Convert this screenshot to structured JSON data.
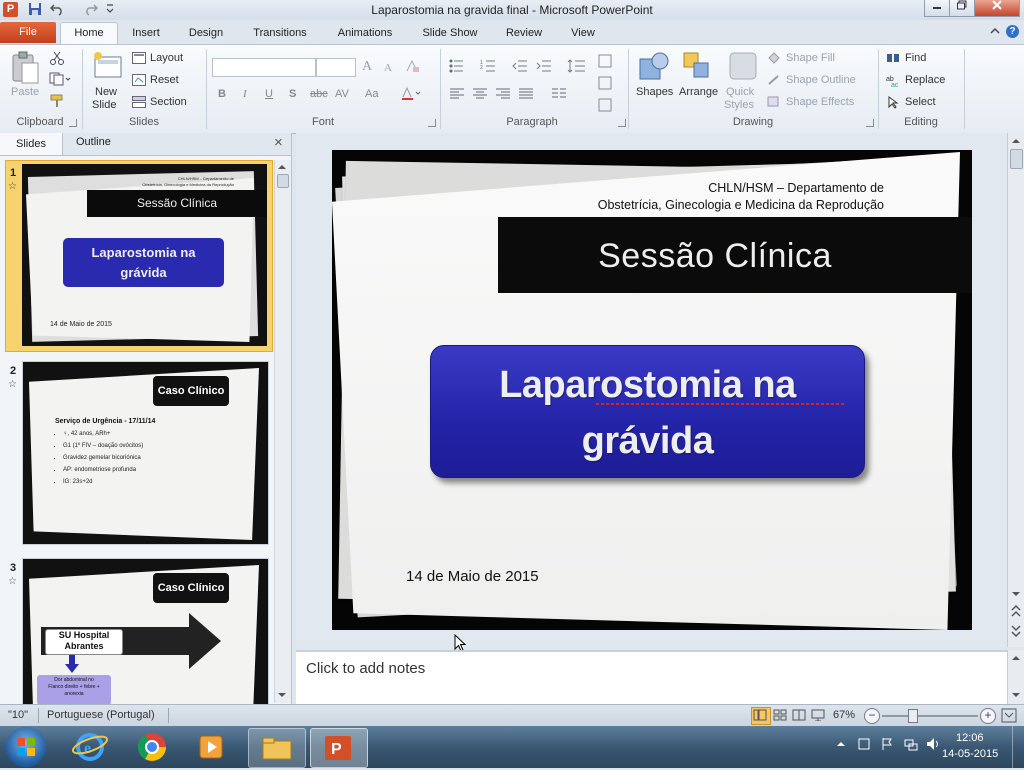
{
  "window": {
    "title": "Laparostomia na gravida final  -  Microsoft PowerPoint",
    "app_icon": "P"
  },
  "ribbon_tabs": [
    "File",
    "Home",
    "Insert",
    "Design",
    "Transitions",
    "Animations",
    "Slide Show",
    "Review",
    "View"
  ],
  "ribbon": {
    "clipboard": {
      "paste": "Paste",
      "label": "Clipboard"
    },
    "slides": {
      "new_slide_1": "New",
      "new_slide_2": "Slide",
      "layout": "Layout",
      "reset": "Reset",
      "section": "Section",
      "label": "Slides"
    },
    "font": {
      "bold": "B",
      "italic": "I",
      "underline": "U",
      "shadow": "S",
      "strike": "abc",
      "spacing": "AV",
      "case": "Aa",
      "grow": "A",
      "shrink": "A",
      "label": "Font"
    },
    "paragraph": {
      "label": "Paragraph"
    },
    "drawing": {
      "shapes": "Shapes",
      "arrange": "Arrange",
      "quick_styles_1": "Quick",
      "quick_styles_2": "Styles",
      "shape_fill": "Shape Fill",
      "shape_outline": "Shape Outline",
      "shape_effects": "Shape Effects",
      "label": "Drawing"
    },
    "editing": {
      "find": "Find",
      "replace": "Replace",
      "select": "Select",
      "label": "Editing"
    }
  },
  "pane": {
    "tabs": [
      "Slides",
      "Outline"
    ],
    "close": "×",
    "thumbnails": [
      {
        "number": "1",
        "dept_line1": "CHLN/HSM  –  Departamento de",
        "dept_line2": "Obstetrícia, Ginecologia e Medicina da Reprodução",
        "session": "Sessão Clínica",
        "title_line1": "Laparostomia na",
        "title_line2": "grávida",
        "date": "14 de Maio de 2015"
      },
      {
        "number": "2",
        "heading": "Caso Clínico",
        "sub": "Serviço de Urgência - 17/11/14",
        "bullets": [
          "♀, 42 anos, ARh+",
          "G1 (1º FIV – doação ovócitos)",
          "Gravidez gemelar bicoriónica",
          "AP: endometriose profunda",
          "IG: 23s+2d"
        ]
      },
      {
        "number": "3",
        "heading": "Caso Clínico",
        "arrow_line1": "SU Hospital",
        "arrow_line2": "Abrantes",
        "box_line1": "Dor abdominal no",
        "box_line2": "Flanco direito + febre +",
        "box_line3": "anorexia"
      }
    ]
  },
  "slide": {
    "dept_line1": "CHLN/HSM  –  Departamento  de",
    "dept_line2": "Obstetrícia, Ginecologia  e  Medicina da Reprodução",
    "session": "Sessão Clínica",
    "title_line1": "Laparostomia na",
    "title_line2": "grávida",
    "date": "14 de Maio de 2015"
  },
  "notes": {
    "placeholder": "Click to add notes"
  },
  "status": {
    "slide_indicator": "\"10\"",
    "language": "Portuguese (Portugal)",
    "zoom": "67%"
  },
  "taskbar": {
    "time": "12:06",
    "date": "14-05-2015"
  },
  "colors": {
    "title_box": "#2a2ab0",
    "file_tab": "#d24f27",
    "selected_thumb": "#f0c23b"
  }
}
